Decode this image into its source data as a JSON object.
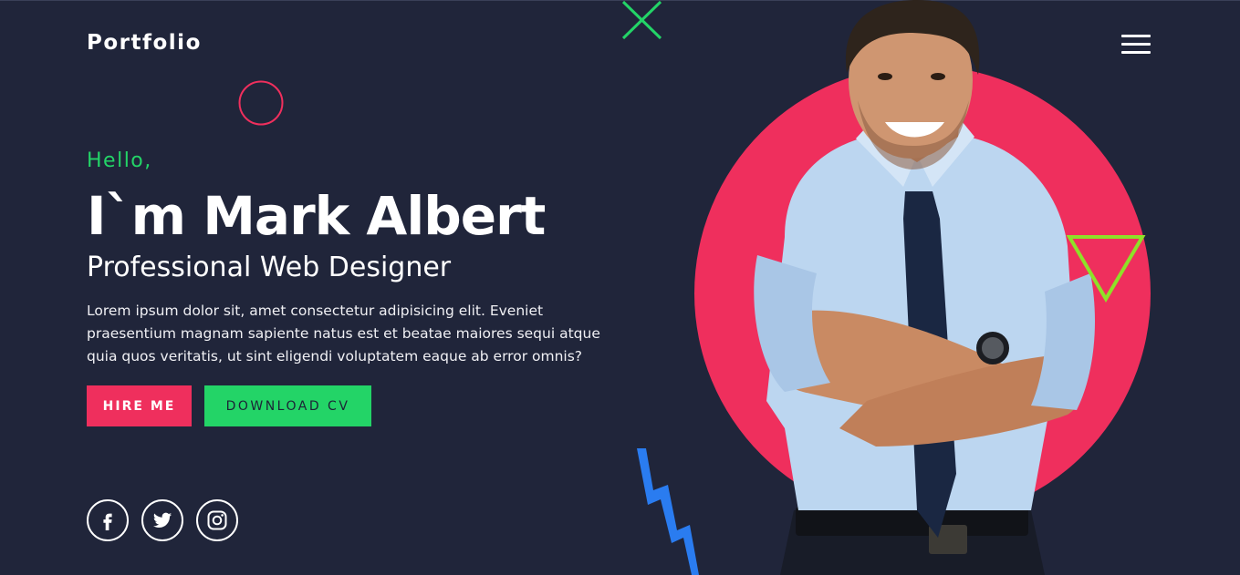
{
  "brand": "Portfolio",
  "menu": {
    "icon": "hamburger-menu-icon"
  },
  "hero": {
    "greeting": "Hello,",
    "name": "I`m Mark Albert",
    "role": "Professional Web Designer",
    "description": "Lorem ipsum dolor sit, amet consectetur adipisicing elit. Eveniet praesentium magnam sapiente natus est et beatae maiores sequi atque quia quos veritatis, ut sint eligendi voluptatem eaque ab error omnis?"
  },
  "buttons": {
    "hire": "HIRE ME",
    "cv": "DOWNLOAD CV"
  },
  "social": [
    {
      "name": "facebook-icon"
    },
    {
      "name": "twitter-icon"
    },
    {
      "name": "instagram-icon"
    }
  ],
  "colors": {
    "background": "#20253a",
    "accent_red": "#ef2f5d",
    "accent_green": "#23d467",
    "accent_lime": "#8ee128",
    "accent_blue": "#2a7cf0"
  },
  "decor": {
    "icons": [
      "x-cross-icon",
      "ring-icon",
      "triangle-icon",
      "zigzag-icon"
    ],
    "portrait": "man-in-shirt-and-tie-photo"
  }
}
